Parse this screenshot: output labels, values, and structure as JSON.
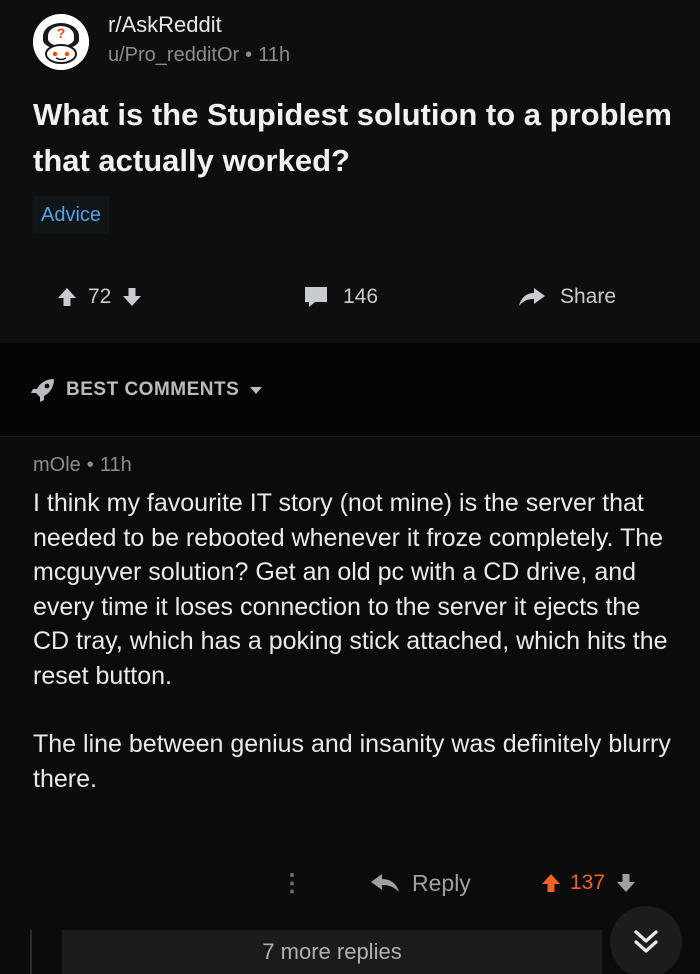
{
  "post": {
    "subreddit": "r/AskReddit",
    "author": "u/Pro_redditOr",
    "separator": "•",
    "age": "11h",
    "title": "What is the Stupidest solution to a problem that actually worked?",
    "flair": "Advice",
    "upvotes": "72",
    "comment_count": "146",
    "share_label": "Share",
    "icons": {
      "avatar": "askreddit-snoo-icon",
      "upvote": "upvote-arrow-icon",
      "downvote": "downvote-arrow-icon",
      "comments": "comment-bubble-icon",
      "share": "share-arrow-icon"
    }
  },
  "sort": {
    "label": "BEST COMMENTS",
    "icons": {
      "sort": "rocket-icon",
      "dropdown": "caret-down-icon"
    }
  },
  "comment": {
    "author": "mOle",
    "separator": "•",
    "age": "11h",
    "body": [
      "I think my favourite IT story (not mine) is the server that needed to be rebooted whenever it froze completely. The mcguyver solution? Get an old pc with a CD drive, and every time it loses connection to the server it ejects the CD tray, which has a poking stick attached, which hits the reset button.",
      "The line between genius and insanity was definitely blurry there."
    ],
    "more_options_label": "⋮",
    "reply_label": "Reply",
    "score": "137",
    "more_replies_label": "7 more replies",
    "colors": {
      "upvoted": "#f0641e"
    },
    "icons": {
      "reply": "reply-arrow-icon",
      "upvote": "upvote-arrow-icon",
      "downvote": "downvote-arrow-icon",
      "collapse": "double-chevron-down-icon"
    }
  }
}
